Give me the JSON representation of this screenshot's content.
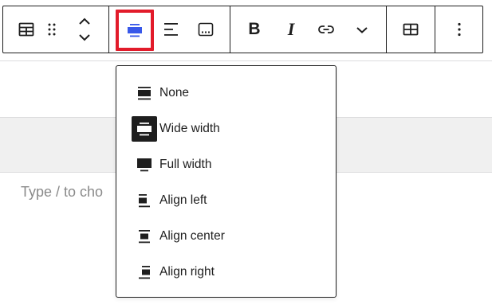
{
  "toolbar": {
    "buttons": [
      {
        "name": "table-block-icon"
      },
      {
        "name": "drag-handle-icon"
      },
      {
        "name": "move-up-down-icon"
      },
      {
        "name": "align-wide-icon",
        "active": true
      },
      {
        "name": "justify-left-icon"
      },
      {
        "name": "caption-icon"
      },
      {
        "name": "bold-icon"
      },
      {
        "name": "italic-icon"
      },
      {
        "name": "link-icon"
      },
      {
        "name": "chevron-down-icon"
      },
      {
        "name": "table-edit-icon"
      },
      {
        "name": "more-options-icon"
      }
    ],
    "bold_label": "B",
    "italic_label": "I"
  },
  "editor": {
    "placeholder": "Type / to cho"
  },
  "align_menu": {
    "items": [
      {
        "label": "None",
        "icon": "align-none-icon"
      },
      {
        "label": "Wide width",
        "icon": "align-wide-icon",
        "selected": true
      },
      {
        "label": "Full width",
        "icon": "align-full-width-icon"
      },
      {
        "label": "Align left",
        "icon": "align-left-icon"
      },
      {
        "label": "Align center",
        "icon": "align-center-icon"
      },
      {
        "label": "Align right",
        "icon": "align-right-icon"
      }
    ]
  },
  "colors": {
    "accent_blue": "#3858e9",
    "highlight_red": "#e21b2a",
    "text_dark": "#1e1e1e"
  }
}
